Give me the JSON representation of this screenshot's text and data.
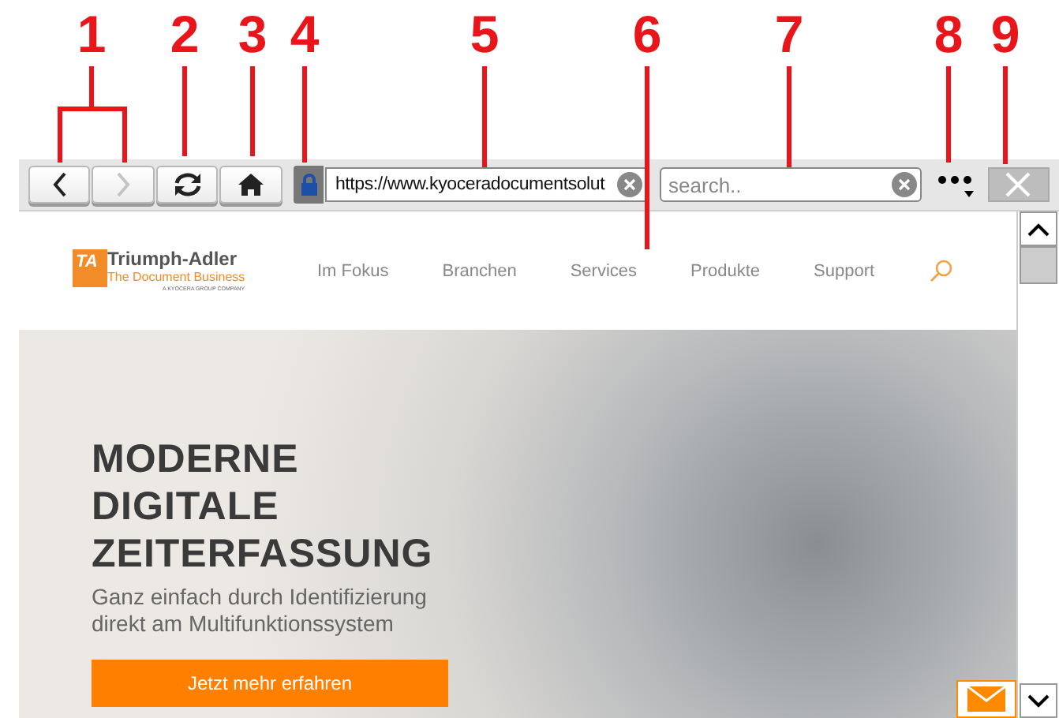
{
  "callouts": [
    "1",
    "2",
    "3",
    "4",
    "5",
    "6",
    "7",
    "8",
    "9"
  ],
  "toolbar": {
    "back": {
      "disabled": false
    },
    "forward": {
      "disabled": true
    },
    "secure": true,
    "url": "https://www.kyoceradocumentsolut",
    "search": {
      "placeholder": "search.."
    },
    "close": {
      "disabled": true
    }
  },
  "page": {
    "logo": {
      "mark": "TA",
      "name": "Triumph-Adler",
      "tagline": "The Document Business",
      "group": "A KYOCERA GROUP COMPANY"
    },
    "nav": [
      "Im Fokus",
      "Branchen",
      "Services",
      "Produkte",
      "Support"
    ],
    "hero": {
      "title": [
        "MODERNE",
        "DIGITALE",
        "ZEITERFASSUNG"
      ],
      "subtitle": [
        "Ganz einfach durch Identifizierung",
        "direkt am Multifunktionssystem"
      ],
      "button": "Jetzt mehr erfahren"
    }
  }
}
